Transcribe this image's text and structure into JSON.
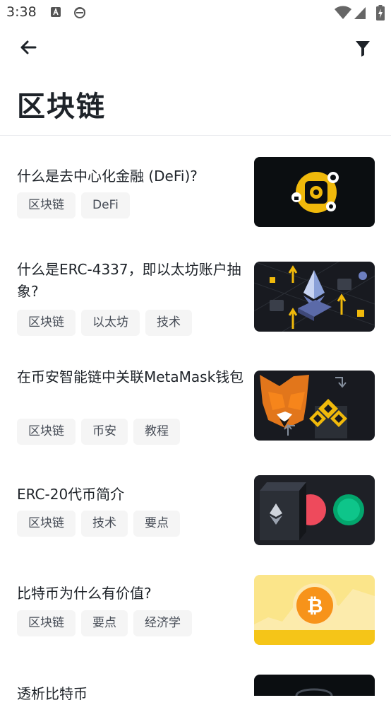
{
  "status": {
    "time": "3:38"
  },
  "header": {
    "title": "区块链"
  },
  "articles": [
    {
      "title": "什么是去中心化金融 (DeFi)?",
      "tags": [
        "区块链",
        "DeFi"
      ],
      "image": "defi-graphic"
    },
    {
      "title": "什么是ERC-4337，即以太坊账户抽象?",
      "tags": [
        "区块链",
        "以太坊",
        "技术"
      ],
      "image": "ethereum-graphic"
    },
    {
      "title": "在币安智能链中关联MetaMask钱包",
      "tags": [
        "区块链",
        "币安",
        "教程"
      ],
      "image": "metamask-bnb-graphic"
    },
    {
      "title": "ERC-20代币简介",
      "tags": [
        "区块链",
        "技术",
        "要点"
      ],
      "image": "erc20-graphic"
    },
    {
      "title": "比特币为什么有价值?",
      "tags": [
        "区块链",
        "要点",
        "经济学"
      ],
      "image": "bitcoin-graphic"
    },
    {
      "title": "透析比特币",
      "tags": [],
      "image": "bitcoin-dark-graphic"
    }
  ],
  "colors": {
    "accent": "#f0b90b",
    "text": "#1e2329",
    "tag_bg": "#f5f5f5"
  },
  "icons": [
    "back-arrow-icon",
    "filter-icon",
    "wifi-icon",
    "signal-icon",
    "battery-icon"
  ]
}
